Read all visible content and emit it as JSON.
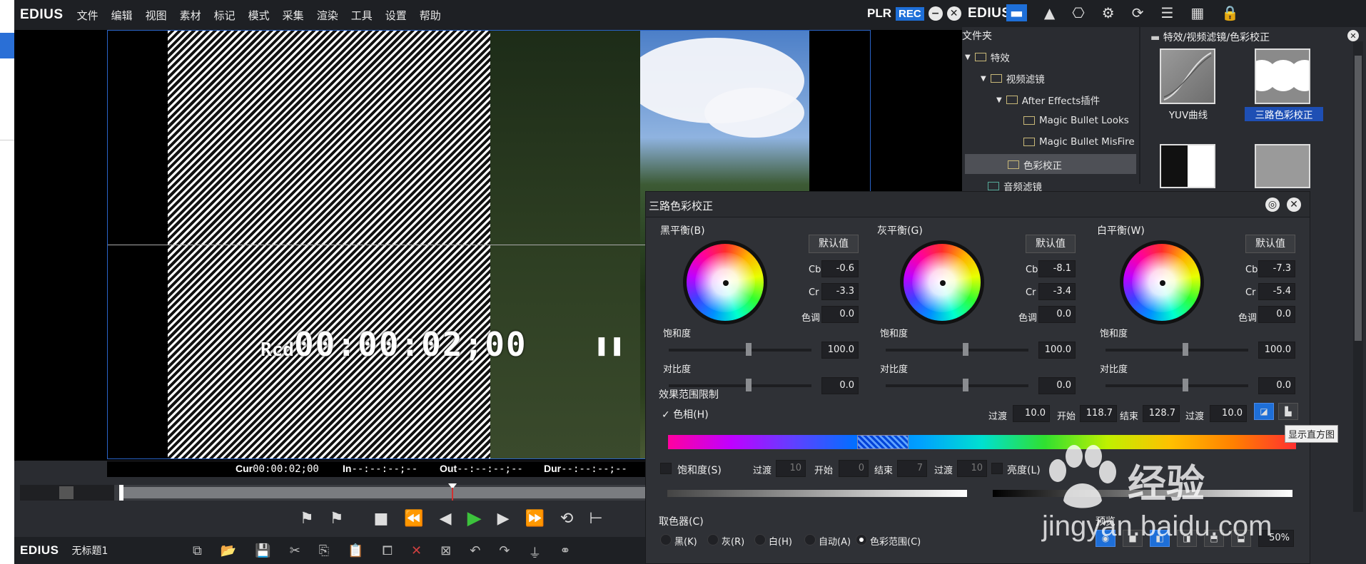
{
  "menubar": {
    "logo": "EDIUS",
    "items": [
      "文件",
      "编辑",
      "视图",
      "素材",
      "标记",
      "模式",
      "采集",
      "渲染",
      "工具",
      "设置",
      "帮助"
    ],
    "plr": "PLR",
    "rec": "REC"
  },
  "player": {
    "timecode_prefix": "Rcd",
    "timecode": "00:00:02;00",
    "cur_label": "Cur",
    "cur_value": "00:00:02;00",
    "in_label": "In",
    "in_value": "--:--:--;--",
    "out_label": "Out",
    "out_value": "--:--:--;--",
    "dur_label": "Dur",
    "dur_value": "--:--:--;--"
  },
  "status": {
    "logo": "EDIUS",
    "project": "无标题1"
  },
  "right": {
    "logo": "EDIUS",
    "folder_header": "文件夹",
    "tree": [
      "特效",
      "视频滤镜",
      "After Effects插件",
      "Magic Bullet Looks",
      "Magic Bullet MisFire",
      "色彩校正",
      "音频滤镜"
    ],
    "gallery_path": "特效/视频滤镜/色彩校正",
    "thumb1": "YUV曲线",
    "thumb2": "三路色彩校正"
  },
  "dialog": {
    "title": "三路色彩校正",
    "default_btn": "默认值",
    "sections": [
      {
        "label": "黑平衡",
        "key": "B",
        "cb": "-0.6",
        "cr": "-3.3",
        "hue": "0.0",
        "sat": "100.0",
        "con": "0.0"
      },
      {
        "label": "灰平衡",
        "key": "G",
        "cb": "-8.1",
        "cr": "-3.4",
        "hue": "0.0",
        "sat": "100.0",
        "con": "0.0"
      },
      {
        "label": "白平衡",
        "key": "W",
        "cb": "-7.3",
        "cr": "-5.4",
        "hue": "0.0",
        "sat": "100.0",
        "con": "0.0"
      }
    ],
    "cb_label": "Cb",
    "cr_label": "Cr",
    "hue_label": "色调",
    "sat_label": "饱和度",
    "con_label": "对比度",
    "range_title": "效果范围限制",
    "hue_check": "色相",
    "hue_key": "H",
    "trans_label": "过渡",
    "trans1": "10.0",
    "start_label": "开始",
    "start": "118.7",
    "end_label": "结束",
    "end": "128.7",
    "trans2": "10.0",
    "sat_check": "饱和度",
    "sat_key": "S",
    "sat_trans1": "10",
    "sat_start": "0",
    "sat_end": "7",
    "sat_trans2": "10",
    "lum_check": "亮度",
    "lum_key": "L",
    "picker_title": "取色器",
    "picker_key": "C",
    "picker": [
      "黑",
      "灰",
      "白",
      "自动",
      "色彩范围"
    ],
    "picker_keys": [
      "K",
      "R",
      "H",
      "A",
      "C"
    ],
    "preview_label": "预览",
    "zoom": "50%"
  },
  "tooltip": "显示直方图",
  "watermark": {
    "text": "经验",
    "url": "jingyan.baidu.com"
  }
}
